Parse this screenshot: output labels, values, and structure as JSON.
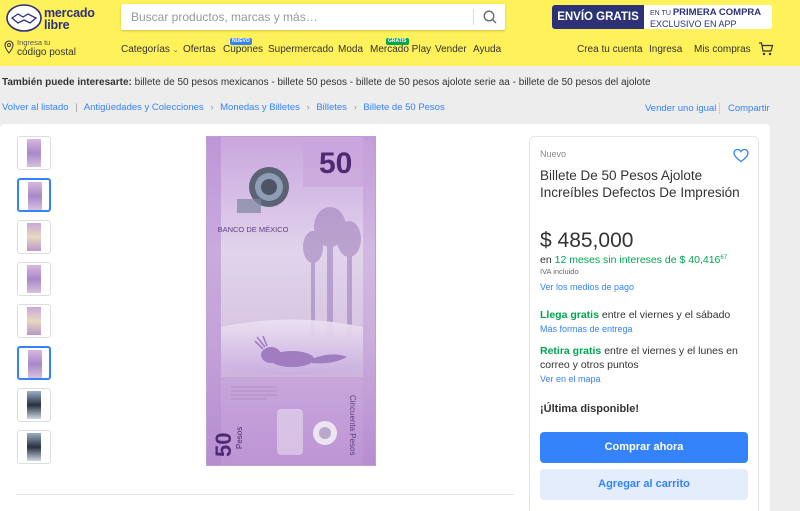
{
  "header": {
    "logo_text_line1": "mercado",
    "logo_text_line2": "libre",
    "search_placeholder": "Buscar productos, marcas y más…",
    "promo_left": "ENVÍO GRATIS",
    "promo_right_line1_prefix": "EN TU ",
    "promo_right_line1_bold": "PRIMERA COMPRA",
    "promo_right_line2": "EXCLUSIVO EN APP",
    "location_small": "Ingresa tu",
    "location_main": "código postal",
    "nav": {
      "categories": "Categorías",
      "offers": "Ofertas",
      "coupons": "Cupones",
      "coupons_badge": "NUEVO",
      "supermarket": "Supermercado",
      "fashion": "Moda",
      "play": "Mercado Play",
      "play_badge": "GRATIS",
      "sell": "Vender",
      "help": "Ayuda",
      "create_account": "Crea tu cuenta",
      "login": "Ingresa",
      "my_purchases": "Mis compras"
    }
  },
  "related": {
    "label": "También puede interesarte:",
    "items": "billete de 50 pesos mexicanos - billete 50 pesos - billete de 50 pesos ajolote serie aa - billete de 50 pesos del ajolote"
  },
  "breadcrumb": {
    "back": "Volver al listado",
    "items": [
      "Antigüedades y Colecciones",
      "Monedas y Billetes",
      "Billetes",
      "Billete de 50 Pesos"
    ],
    "sell_same": "Vender uno igual",
    "share": "Compartir"
  },
  "product": {
    "condition": "Nuevo",
    "title": "Billete De 50 Pesos Ajolote Increíbles Defectos De Impresión",
    "price": "$ 485,000",
    "installments_prefix": "en ",
    "installments_green": "12 meses sin intereses de $ 40,416",
    "installments_cents": "67",
    "iva": "IVA incluido",
    "payment_link": "Ver los medios de pago",
    "shipping_bold": "Llega gratis",
    "shipping_rest": " entre el viernes y el sábado",
    "shipping_link": "Más formas de entrega",
    "pickup_bold": "Retira gratis",
    "pickup_rest": " entre el viernes y el lunes en correo y otros puntos",
    "map_link": "Ver en el mapa",
    "stock": "¡Última disponible!",
    "buy_now": "Comprar ahora",
    "add_to_cart": "Agregar al carrito"
  },
  "banknote": {
    "denomination": "50",
    "bank_name": "BANCO DE MÉXICO",
    "side_text": "Cincuenta Pesos",
    "bottom_denomination": "50",
    "bottom_word": "Pesos"
  },
  "colors": {
    "header_bg": "#fff159",
    "brand_blue": "#2d3277",
    "accent": "#3483fa",
    "green": "#00a650",
    "note_purple": "#b48cd0"
  }
}
